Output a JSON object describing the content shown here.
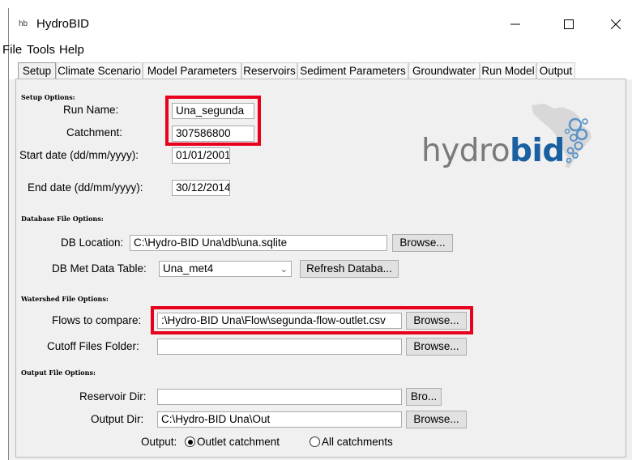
{
  "window": {
    "icon_text": "hb",
    "title": "HydroBID",
    "minimize_icon": "minimize-icon",
    "maximize_icon": "maximize-icon",
    "close_icon": "close-icon"
  },
  "menu": [
    "File",
    "Tools",
    "Help"
  ],
  "tabs": [
    {
      "label": "Setup",
      "active": true
    },
    {
      "label": "Climate Scenario"
    },
    {
      "label": "Model Parameters"
    },
    {
      "label": "Reservoirs"
    },
    {
      "label": "Sediment Parameters"
    },
    {
      "label": "Groundwater"
    },
    {
      "label": "Run Model"
    },
    {
      "label": "Output"
    }
  ],
  "setup": {
    "section": "Setup Options:",
    "run_name_label": "Run Name:",
    "run_name_value": "Una_segunda",
    "catchment_label": "Catchment:",
    "catchment_value": "307586800",
    "start_label": "Start date (dd/mm/yyyy):",
    "start_value": "01/01/2001",
    "end_label": "End date (dd/mm/yyyy):",
    "end_value": "30/12/2014"
  },
  "logo": {
    "light": "hydro",
    "bold": "bid"
  },
  "database": {
    "section": "Database File Options:",
    "db_location_label": "DB Location:",
    "db_location_value": "C:\\Hydro-BID Una\\db\\una.sqlite",
    "browse_label": "Browse...",
    "met_table_label": "DB Met Data Table:",
    "met_table_value": "Una_met4",
    "refresh_label": "Refresh Databa..."
  },
  "watershed": {
    "section": "Watershed File Options:",
    "flows_label": "Flows to compare:",
    "flows_value": ":\\Hydro-BID Una\\Flow\\segunda-flow-outlet.csv",
    "flows_browse": "Browse...",
    "cutoff_label": "Cutoff Files Folder:",
    "cutoff_value": "",
    "cutoff_browse": "Browse..."
  },
  "output": {
    "section": "Output File Options:",
    "reservoir_label": "Reservoir Dir:",
    "reservoir_value": "",
    "reservoir_browse": "Bro...",
    "outdir_label": "Output Dir:",
    "outdir_value": "C:\\Hydro-BID Una\\Out",
    "outdir_browse": "Browse...",
    "output_label": "Output:",
    "radio_outlet": "Outlet catchment",
    "radio_all": "All catchments",
    "selected": "Outlet catchment"
  },
  "colors": {
    "highlight": "#e8001c",
    "logo_bold": "#1a5fa0"
  }
}
